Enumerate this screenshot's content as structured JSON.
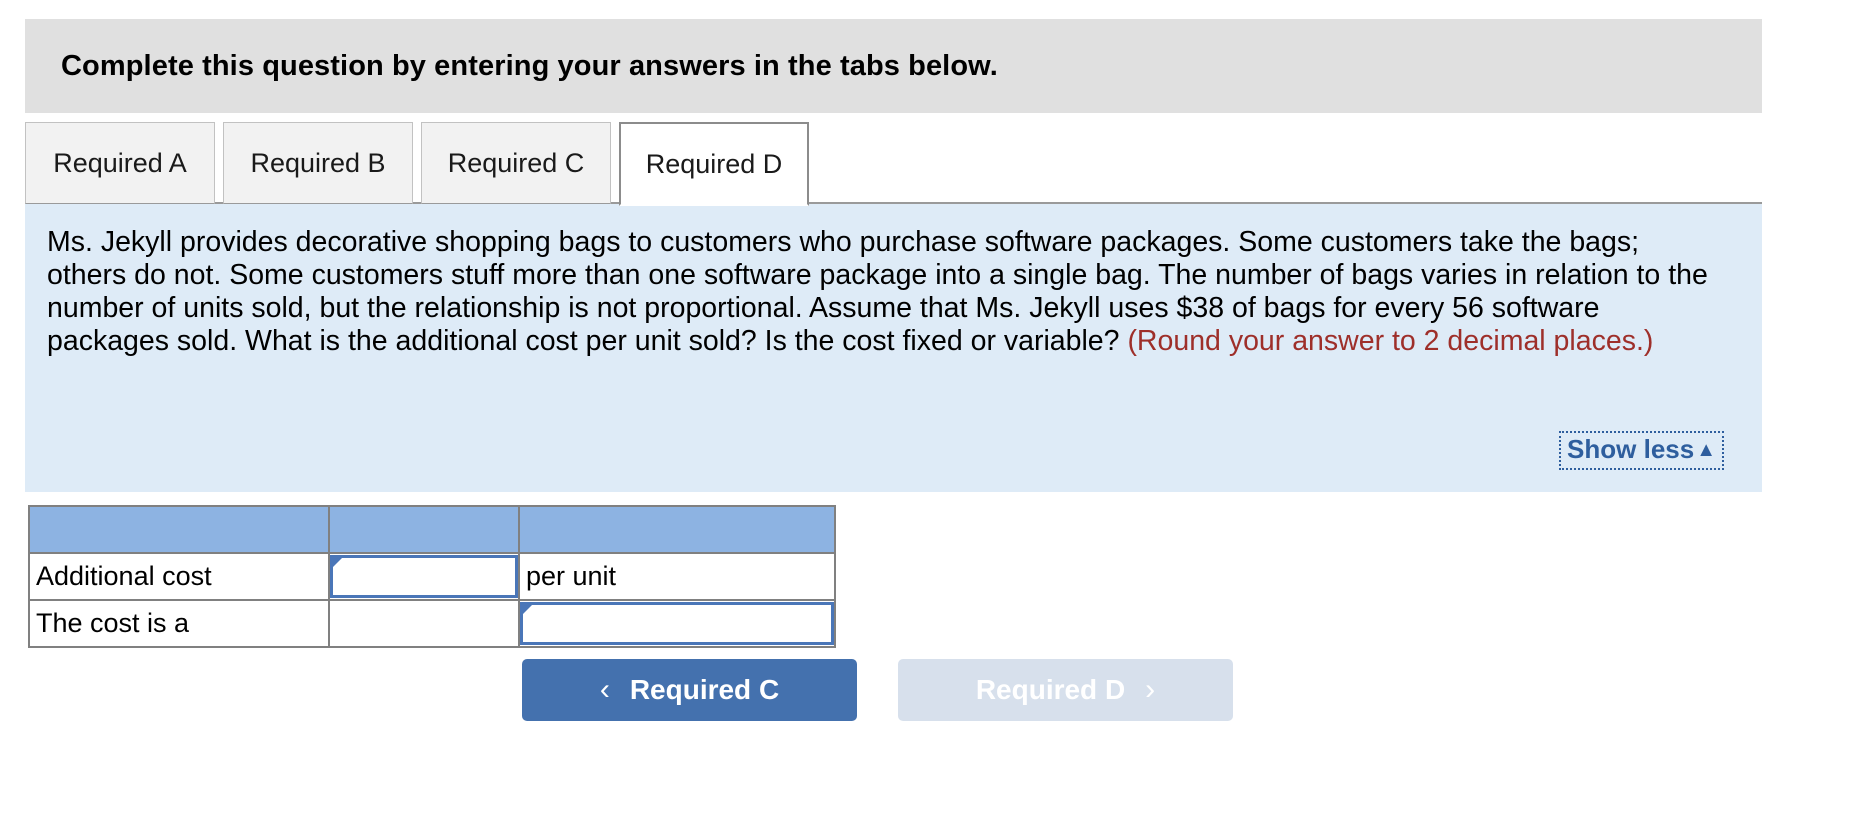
{
  "instruction": {
    "text": "Complete this question by entering your answers in the tabs below."
  },
  "tabs": [
    {
      "label": "Required A",
      "active": false
    },
    {
      "label": "Required B",
      "active": false
    },
    {
      "label": "Required C",
      "active": false
    },
    {
      "label": "Required D",
      "active": true
    }
  ],
  "question": {
    "body_main": "Ms. Jekyll provides decorative shopping bags to customers who purchase software packages. Some customers take the bags; others do not. Some customers stuff more than one software package into a single bag. The number of bags varies in relation to the number of units sold, but the relationship is not proportional. Assume that Ms. Jekyll uses $38 of bags for every 56 software packages sold. What is the additional cost per unit sold? Is the cost fixed or variable? ",
    "round_note": "(Round your answer to 2 decimal places.)",
    "show_less_label": "Show less",
    "show_less_caret": "▲"
  },
  "answer_table": {
    "header": [
      "",
      "",
      ""
    ],
    "rows": [
      {
        "label": "Additional cost",
        "input_value": "",
        "input_placeholder": "",
        "suffix": "per unit"
      },
      {
        "label": "The cost is a",
        "input_value": "",
        "input_placeholder": "",
        "suffix": ""
      }
    ]
  },
  "navigation": {
    "prev_label": "Required C",
    "prev_icon": "chevron-left-icon",
    "prev_chevron": "‹",
    "next_label": "Required D",
    "next_icon": "chevron-right-icon",
    "next_chevron": "›",
    "next_disabled": true
  },
  "colors": {
    "banner_bg": "#e0e0e0",
    "question_bg": "#deebf7",
    "table_header_bg": "#8db3e2",
    "input_border": "#4a76b8",
    "accent_blue": "#4471ae",
    "note_red": "#9e2f2a",
    "link_blue": "#2e5e9e",
    "disabled_btn_bg": "#d7e0ec"
  }
}
